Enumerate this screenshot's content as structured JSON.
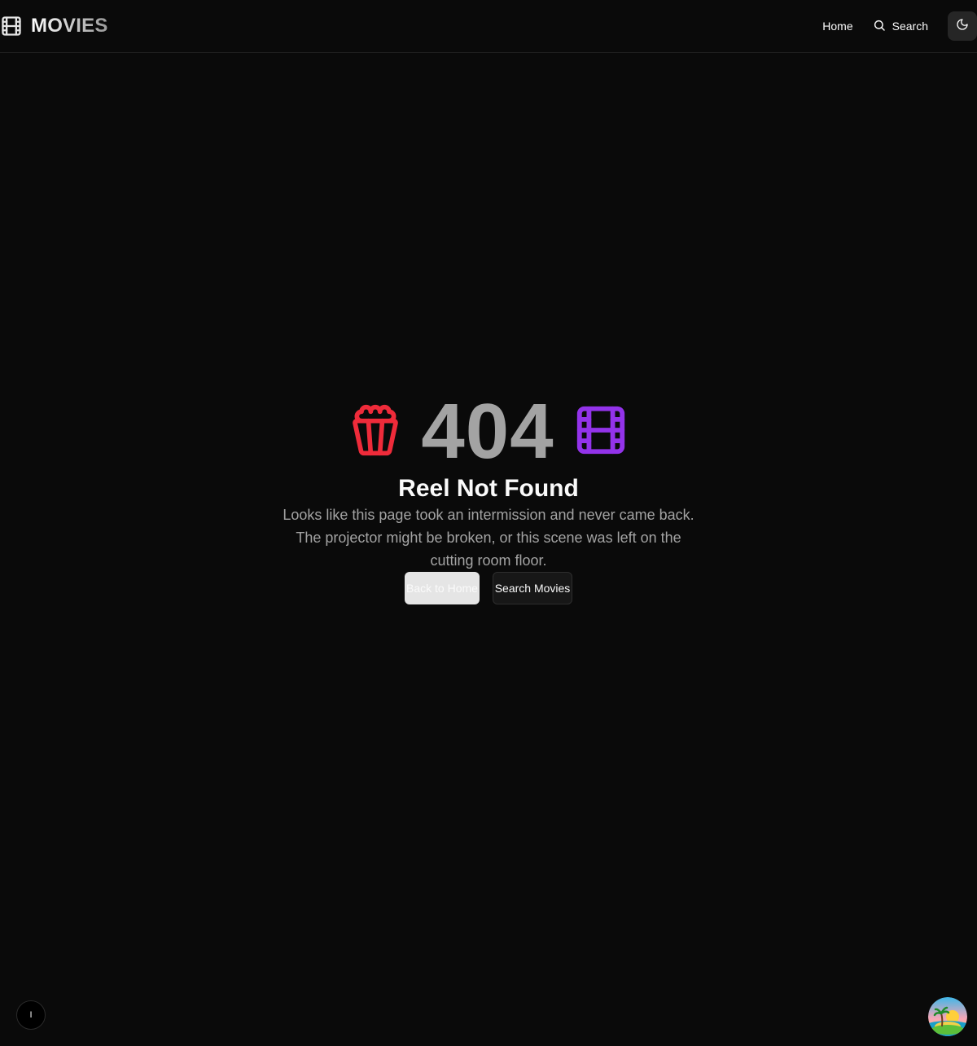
{
  "header": {
    "brand": "MOVIES",
    "nav": {
      "home_label": "Home",
      "search_label": "Search"
    },
    "icons": {
      "brand": "film-icon",
      "search": "search-icon",
      "theme": "moon-icon"
    }
  },
  "error": {
    "code": "404",
    "title": "Reel Not Found",
    "description": "Looks like this page took an intermission and never came back. The projector might be broken, or this scene was left on the cutting room floor.",
    "icons": {
      "left": "popcorn-icon",
      "right": "film-icon"
    },
    "colors": {
      "popcorn": "#ef2b3a",
      "film": "#9333ea",
      "code": "#a3a3a3"
    }
  },
  "actions": {
    "back_home_label": "Back to Home",
    "search_movies_label": "Search Movies"
  },
  "floating": {
    "left_button_label": "I",
    "right_icon": "island-sunset-avatar"
  }
}
